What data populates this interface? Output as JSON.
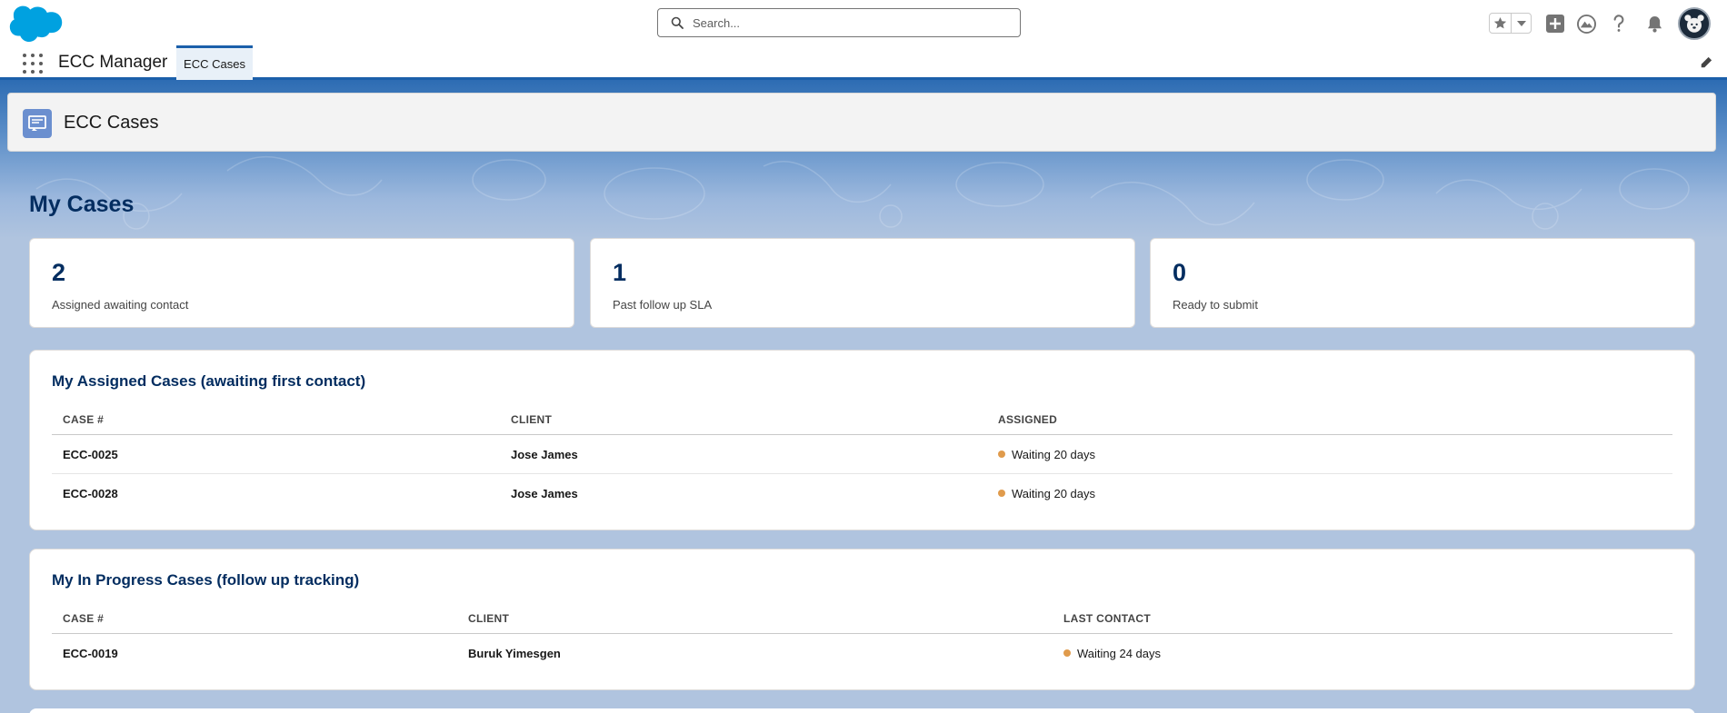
{
  "header": {
    "search_placeholder": "Search..."
  },
  "context": {
    "app_name": "ECC Manager",
    "tab_label": "ECC Cases"
  },
  "page": {
    "title": "ECC Cases",
    "section_title": "My Cases"
  },
  "stats": [
    {
      "value": "2",
      "label": "Assigned awaiting contact"
    },
    {
      "value": "1",
      "label": "Past follow up SLA"
    },
    {
      "value": "0",
      "label": "Ready to submit"
    }
  ],
  "assigned_table": {
    "title": "My Assigned Cases (awaiting first contact)",
    "headers": [
      "CASE #",
      "CLIENT",
      "ASSIGNED"
    ],
    "rows": [
      {
        "case": "ECC-0025",
        "client": "Jose James",
        "status": "Waiting 20 days"
      },
      {
        "case": "ECC-0028",
        "client": "Jose James",
        "status": "Waiting 20 days"
      }
    ]
  },
  "progress_table": {
    "title": "My In Progress Cases (follow up tracking)",
    "headers": [
      "CASE #",
      "CLIENT",
      "LAST CONTACT"
    ],
    "rows": [
      {
        "case": "ECC-0019",
        "client": "Buruk Yimesgen",
        "status": "Waiting 24 days"
      }
    ]
  },
  "colors": {
    "brand": "#1b5faa",
    "heading": "#032d60",
    "status_dot": "#e09b4c",
    "page_bg": "#b0c4df"
  }
}
